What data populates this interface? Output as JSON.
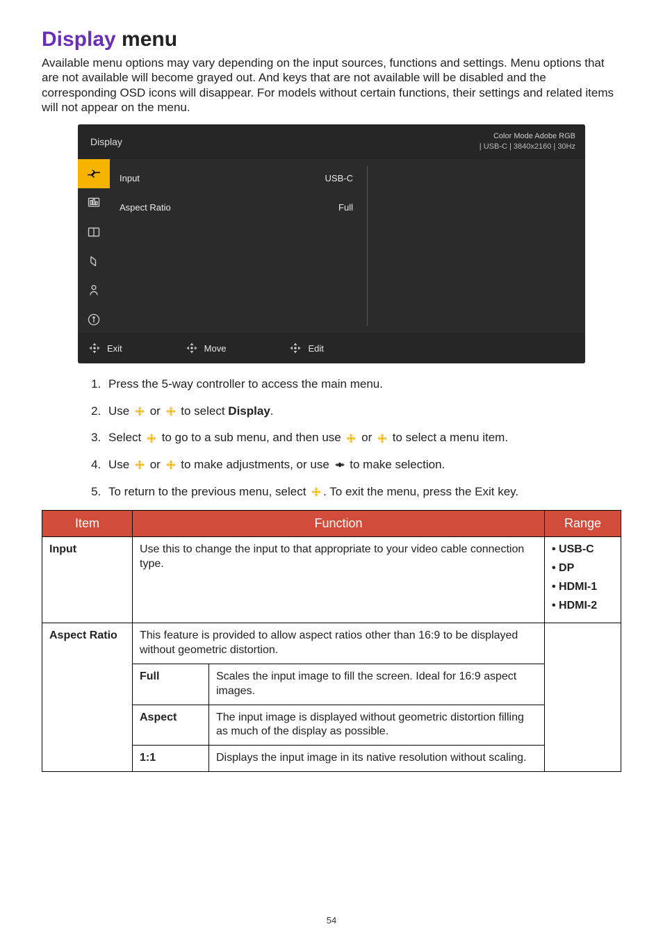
{
  "title_purple": "Display",
  "title_rest": " menu",
  "intro": "Available menu options may vary depending on the input sources, functions and settings. Menu options that are not available will become grayed out. And keys that are not available will be disabled and the corresponding OSD icons will disappear. For models without certain functions, their settings and related items will not appear on the menu.",
  "osd": {
    "title": "Display",
    "status_line1": "Color Mode   Adobe RGB",
    "status_line2": "|   USB-C   |   3840x2160    | 30Hz",
    "items": [
      {
        "label": "Input",
        "value": "USB-C"
      },
      {
        "label": "Aspect Ratio",
        "value": "Full"
      }
    ],
    "footer": {
      "exit": "Exit",
      "move": "Move",
      "edit": "Edit"
    }
  },
  "steps": {
    "s1": "Press the 5-way controller to access the main menu.",
    "s2a": "Use ",
    "s2b": " or ",
    "s2c": " to select ",
    "s2d": "Display",
    "s2e": ".",
    "s3a": "Select ",
    "s3b": " to go to a sub menu, and then use ",
    "s3c": " or ",
    "s3d": " to select a menu item.",
    "s4a": "Use ",
    "s4b": " or ",
    "s4c": " to make adjustments, or use ",
    "s4d": " to make selection.",
    "s5a": "To return to the previous menu, select ",
    "s5b": ". To exit the menu, press the Exit key."
  },
  "table": {
    "headers": {
      "item": "Item",
      "function": "Function",
      "range": "Range"
    },
    "input": {
      "name": "Input",
      "desc": "Use this to change the input to that appropriate to your video cable connection type.",
      "range": [
        "USB-C",
        "DP",
        "HDMI-1",
        "HDMI-2"
      ]
    },
    "aspect": {
      "name": "Aspect Ratio",
      "desc": "This feature is provided to allow aspect ratios other than 16:9 to be displayed without geometric distortion.",
      "full": {
        "name": "Full",
        "desc": "Scales the input image to fill the screen. Ideal for 16:9 aspect images."
      },
      "aspect_opt": {
        "name": "Aspect",
        "desc": "The input image is displayed without geometric distortion filling as much of the display as possible."
      },
      "one": {
        "name": "1:1",
        "desc": "Displays the input image in its native resolution without scaling."
      }
    }
  },
  "page_number": "54"
}
